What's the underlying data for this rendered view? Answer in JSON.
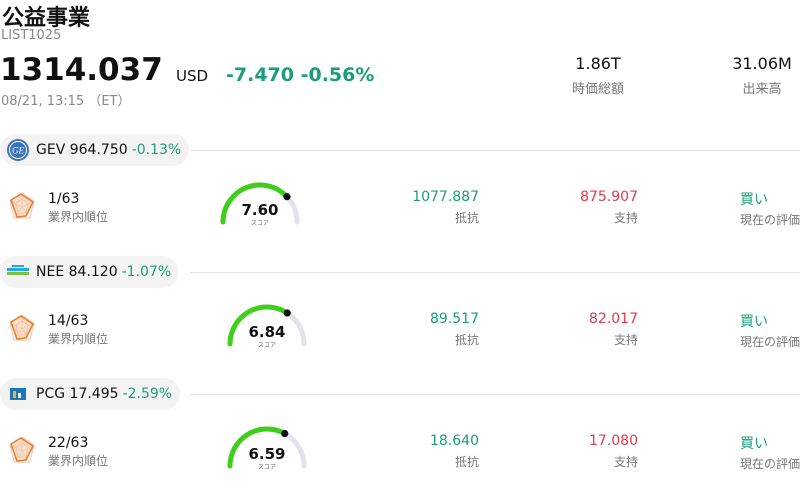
{
  "header": {
    "title": "公益事業",
    "code": "LIST1025",
    "price": "1314.037",
    "currency": "USD",
    "change": "-7.470",
    "change_pct": "-0.56%",
    "timestamp": "08/21, 13:15 （ET）",
    "market_cap_value": "1.86T",
    "market_cap_label": "時価総額",
    "volume_value": "31.06M",
    "volume_label": "出来高"
  },
  "colors": {
    "positive_text": "#1a9e7a",
    "negative_text": "#e23a4a",
    "gauge_fill": "#3fce1a",
    "gauge_track": "#e2e2ea",
    "radar_accent": "#f07a2a"
  },
  "stocks": [
    {
      "symbol": "GEV",
      "price": "964.750",
      "change_pct": "-0.13%",
      "logo_icon": "ge-logo-icon",
      "rank": "1/63",
      "rank_label": "業界内順位",
      "score": "7.60",
      "score_fraction": 0.76,
      "score_label": "スコア",
      "resistance": "1077.887",
      "resistance_label": "抵抗",
      "support": "875.907",
      "support_label": "支持",
      "rating": "買い",
      "rating_label": "現在の評価"
    },
    {
      "symbol": "NEE",
      "price": "84.120",
      "change_pct": "-1.07%",
      "logo_icon": "nextera-logo-icon",
      "rank": "14/63",
      "rank_label": "業界内順位",
      "score": "6.84",
      "score_fraction": 0.684,
      "score_label": "スコア",
      "resistance": "89.517",
      "resistance_label": "抵抗",
      "support": "82.017",
      "support_label": "支持",
      "rating": "買い",
      "rating_label": "現在の評価"
    },
    {
      "symbol": "PCG",
      "price": "17.495",
      "change_pct": "-2.59%",
      "logo_icon": "pge-logo-icon",
      "rank": "22/63",
      "rank_label": "業界内順位",
      "score": "6.59",
      "score_fraction": 0.659,
      "score_label": "スコア",
      "resistance": "18.640",
      "resistance_label": "抵抗",
      "support": "17.080",
      "support_label": "支持",
      "rating": "買い",
      "rating_label": "現在の評価"
    }
  ]
}
